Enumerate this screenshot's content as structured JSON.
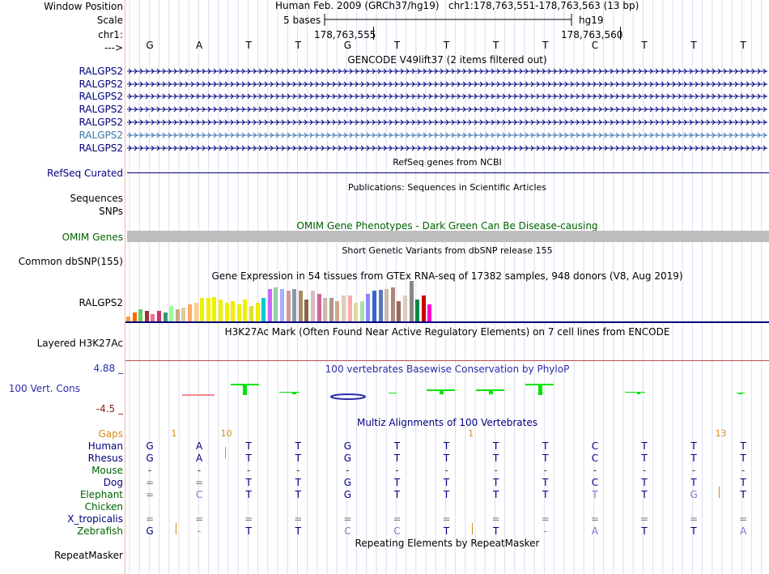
{
  "colors": {
    "label_navy": "#000080",
    "label_teal": "#3a74a8",
    "label_green": "#006400",
    "label_orange": "#d48c1a",
    "conservation_blue": "#2b2bab",
    "conservation_red": "#8b2020",
    "phylop_positive": "#00e600",
    "phylop_negative": "#e61a1a",
    "omim_bar": "#bebebe",
    "grid": "#dcdcf0"
  },
  "labels": {
    "window_position": "Window Position",
    "scale": "Scale",
    "chr": "chr1:",
    "strand": "--->",
    "gene_rows": [
      "RALGPS2",
      "RALGPS2",
      "RALGPS2",
      "RALGPS2",
      "RALGPS2",
      "RALGPS2",
      "RALGPS2"
    ],
    "refseq": "RefSeq Curated",
    "sequences": "Sequences",
    "snps": "SNPs",
    "omim": "OMIM Genes",
    "dbsnp": "Common dbSNP(155)",
    "gtex": "RALGPS2",
    "h3k27ac": "Layered H3K27Ac",
    "cons_max": "4.88 _",
    "cons_name": "100 Vert. Cons",
    "cons_min": "-4.5 _",
    "gaps": "Gaps",
    "species": [
      "Human",
      "Rhesus",
      "Mouse",
      "Dog",
      "Elephant",
      "Chicken",
      "X_tropicalis",
      "Zebrafish"
    ],
    "repeatmasker": "RepeatMasker"
  },
  "header": {
    "assembly": "Human Feb. 2009 (GRCh37/hg19)",
    "position": "chr1:178,763,551-178,763,563 (13 bp)",
    "scale_label": "5 bases",
    "scale_db": "hg19",
    "coord_left": "178,763,555",
    "coord_right": "178,763,560"
  },
  "bases": [
    "G",
    "A",
    "T",
    "T",
    "G",
    "T",
    "T",
    "T",
    "T",
    "C",
    "T",
    "T",
    "T"
  ],
  "tracks": {
    "gencode": "GENCODE V49lift37 (2 items filtered out)",
    "refseq": "RefSeq genes from NCBI",
    "publications": "Publications: Sequences in Scientific Articles",
    "omim": "OMIM Gene Phenotypes - Dark Green Can Be Disease-causing",
    "dbsnp": "Short Genetic Variants from dbSNP release 155",
    "gtex": "Gene Expression in 54 tissues from GTEx RNA-seq of 17382 samples, 948 donors (V8, Aug 2019)",
    "h3k27ac": "H3K27Ac Mark (Often Found Near Active Regulatory Elements) on 7 cell lines from ENCODE",
    "conservation": "100 vertebrates Basewise Conservation by PhyloP",
    "multiz": "Multiz Alignments of 100 Vertebrates",
    "repeatmasker": "Repeating Elements by RepeatMasker"
  },
  "gap_counts": [
    {
      "text": "1",
      "base_index": 0.5
    },
    {
      "text": "10",
      "base_index": 1.5
    },
    {
      "text": "1",
      "base_index": 6.5
    },
    {
      "text": "13",
      "base_index": 11.5
    }
  ],
  "alignment": {
    "Human": [
      "G",
      "A",
      "T",
      "T",
      "G",
      "T",
      "T",
      "T",
      "T",
      "C",
      "T",
      "T",
      "T"
    ],
    "Rhesus": [
      "G",
      "A",
      "T",
      "T",
      "G",
      "T",
      "T",
      "T",
      "T",
      "C",
      "T",
      "T",
      "T"
    ],
    "Mouse": [
      "-",
      "-",
      "-",
      "-",
      "-",
      "-",
      "-",
      "-",
      "-",
      "-",
      "-",
      "-",
      "-"
    ],
    "Dog": [
      "=",
      "=",
      "T",
      "T",
      "G",
      "T",
      "T",
      "T",
      "T",
      "C",
      "T",
      "T",
      "T"
    ],
    "Elephant": [
      "=",
      "C",
      "T",
      "T",
      "G",
      "T",
      "T",
      "T",
      "T",
      "T",
      "T",
      "G",
      "T"
    ],
    "Chicken": [
      "",
      "",
      "",
      "",
      "",
      "",
      "",
      "",
      "",
      "",
      "",
      "",
      ""
    ],
    "X_tropicalis": [
      "=",
      "=",
      "=",
      "=",
      "=",
      "=",
      "=",
      "=",
      "=",
      "=",
      "=",
      "=",
      "="
    ],
    "Zebrafish": [
      "G",
      "-",
      "T",
      "T",
      "C",
      "C",
      "T",
      "T",
      "-",
      "A",
      "T",
      "T",
      "A"
    ]
  },
  "gtex_bar_colors": [
    "#ff9933",
    "#ff6600",
    "#66cc66",
    "#993333",
    "#ff6699",
    "#cc3366",
    "#339966",
    "#99ff99",
    "#ccaa88",
    "#ddcc99",
    "#ffaa66",
    "#ffcc88",
    "#eeee00",
    "#eeee00",
    "#eeee00",
    "#eeee00",
    "#eeee00",
    "#eeee00",
    "#eeee00",
    "#eeee00",
    "#dddd33",
    "#eeee00",
    "#00cccc",
    "#cc66ff",
    "#99ccaa",
    "#aaaaff",
    "#cc9999",
    "#8899aa",
    "#aa8866",
    "#886644",
    "#ddbbbb",
    "#cc6699",
    "#ccbbaa",
    "#aa9988",
    "#ccaa88",
    "#ddccbb",
    "#ffaaaa",
    "#dddd99",
    "#aaddaa",
    "#8888ff",
    "#3366cc",
    "#5577bb",
    "#ccbbaa",
    "#aa8877",
    "#996655",
    "#ddccbb",
    "#888888",
    "#008844",
    "#cc0000",
    "#ff00cc"
  ],
  "gtex_values": [
    0.15,
    0.25,
    0.35,
    0.3,
    0.22,
    0.3,
    0.25,
    0.45,
    0.35,
    0.4,
    0.5,
    0.55,
    0.7,
    0.7,
    0.72,
    0.65,
    0.55,
    0.6,
    0.5,
    0.65,
    0.45,
    0.55,
    0.7,
    0.95,
    1.0,
    0.95,
    0.9,
    0.95,
    0.9,
    0.65,
    0.9,
    0.8,
    0.7,
    0.7,
    0.6,
    0.75,
    0.75,
    0.55,
    0.6,
    0.8,
    0.9,
    0.92,
    0.95,
    1.0,
    0.6,
    0.75,
    1.2,
    0.65,
    0.75,
    0.5
  ]
}
